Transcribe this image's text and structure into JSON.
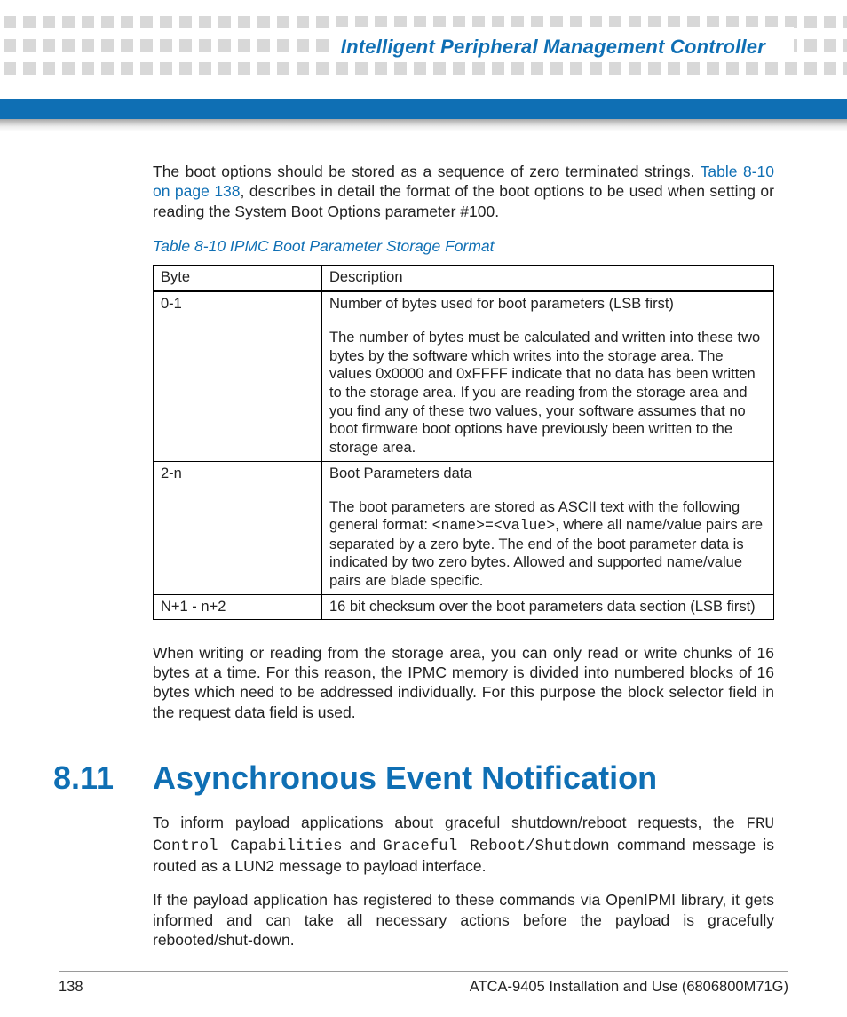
{
  "header": {
    "title": "Intelligent Peripheral Management Controller"
  },
  "intro": {
    "p1_a": "The boot options should be stored as a sequence of zero terminated strings. ",
    "p1_link": "Table 8-10 on page 138",
    "p1_b": ", describes in detail the format of the boot options to be used when setting or reading the System Boot Options parameter #100."
  },
  "table": {
    "caption": "Table 8-10 IPMC Boot Parameter Storage Format",
    "head": {
      "c0": "Byte",
      "c1": "Description"
    },
    "rows": [
      {
        "byte": "0-1",
        "lead": "Number of bytes used for boot parameters (LSB first)",
        "body": "The number of bytes must be calculated and written into these two bytes by the software which writes into the storage area. The values 0x0000 and 0xFFFF indicate that no data has been written to the storage area. If you are reading from the storage area and you find any of these two values, your software assumes that no boot firmware boot options have previously been written to the storage area."
      },
      {
        "byte": "2-n",
        "lead": "Boot Parameters data",
        "body_a": "The boot parameters are stored as ASCII text with the following general format: ",
        "body_mono": "<name>=<value>",
        "body_b": ", where all name/value pairs are separated by a zero byte. The end of the boot parameter data is indicated by two zero bytes. Allowed and supported name/value pairs are blade specific."
      },
      {
        "byte": "N+1 - n+2",
        "lead": "",
        "body": "16 bit checksum over the boot parameters data section (LSB first)"
      }
    ]
  },
  "after_table": "When writing or reading from the storage area, you can only read or write chunks of 16 bytes at a time. For this reason, the IPMC memory is divided into numbered blocks of 16 bytes which need to be addressed individually. For this purpose the block selector field in the request data field is used.",
  "section": {
    "num": "8.11",
    "title": "Asynchronous Event Notification",
    "p1_a": "To inform payload applications about graceful shutdown/reboot requests, the ",
    "p1_mono1": "FRU Control Capabilities",
    "p1_mid": " and ",
    "p1_mono2": "Graceful Reboot/Shutdown",
    "p1_b": " command message is routed as a LUN2 message to payload interface.",
    "p2": "If the payload application has registered to these commands via OpenIPMI library, it gets informed and can take all necessary actions before the payload is gracefully rebooted/shut-down."
  },
  "footer": {
    "page": "138",
    "doc": "ATCA-9405 Installation and Use (6806800M71G)"
  }
}
